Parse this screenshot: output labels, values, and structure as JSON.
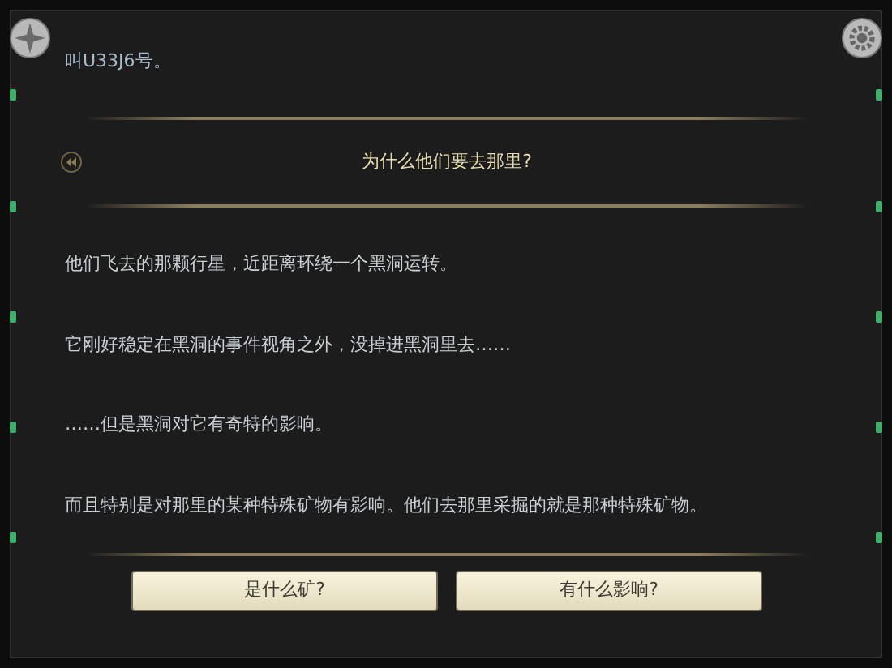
{
  "previous_line": "叫U33J6号。",
  "dialog": {
    "title": "为什么他们要去那里?",
    "paragraphs": [
      "他们飞去的那颗行星，近距离环绕一个黑洞运转。",
      "它刚好稳定在黑洞的事件视角之外，没掉进黑洞里去……",
      "……但是黑洞对它有奇特的影响。",
      "而且特别是对那里的某种特殊矿物有影响。他们去那里采掘的就是那种特殊矿物。"
    ]
  },
  "choices": [
    "是什么矿?",
    "有什么影响?"
  ]
}
